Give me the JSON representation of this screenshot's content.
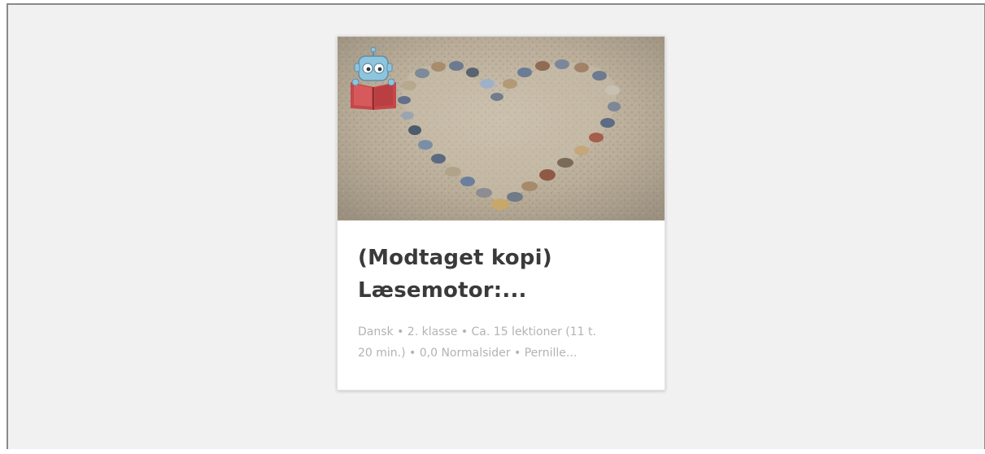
{
  "card": {
    "title_line1": "(Modtaget kopi)",
    "title_line2": "Læsemotor:...",
    "meta_line1": "Dansk • 2. klasse • Ca. 15 lektioner (11 t.",
    "meta_line2": "20 min.) • 0,0 Normalsider • Pernille..."
  },
  "icons": {
    "badge": "robot-reading-book-icon",
    "image": "heart-of-stones-on-sand-image"
  },
  "colors": {
    "background": "#f1f1f1",
    "card": "#ffffff",
    "title": "#3a3a3a",
    "meta": "#b3b3b3",
    "book": "#c5474a",
    "robot": "#8ec5dd"
  }
}
